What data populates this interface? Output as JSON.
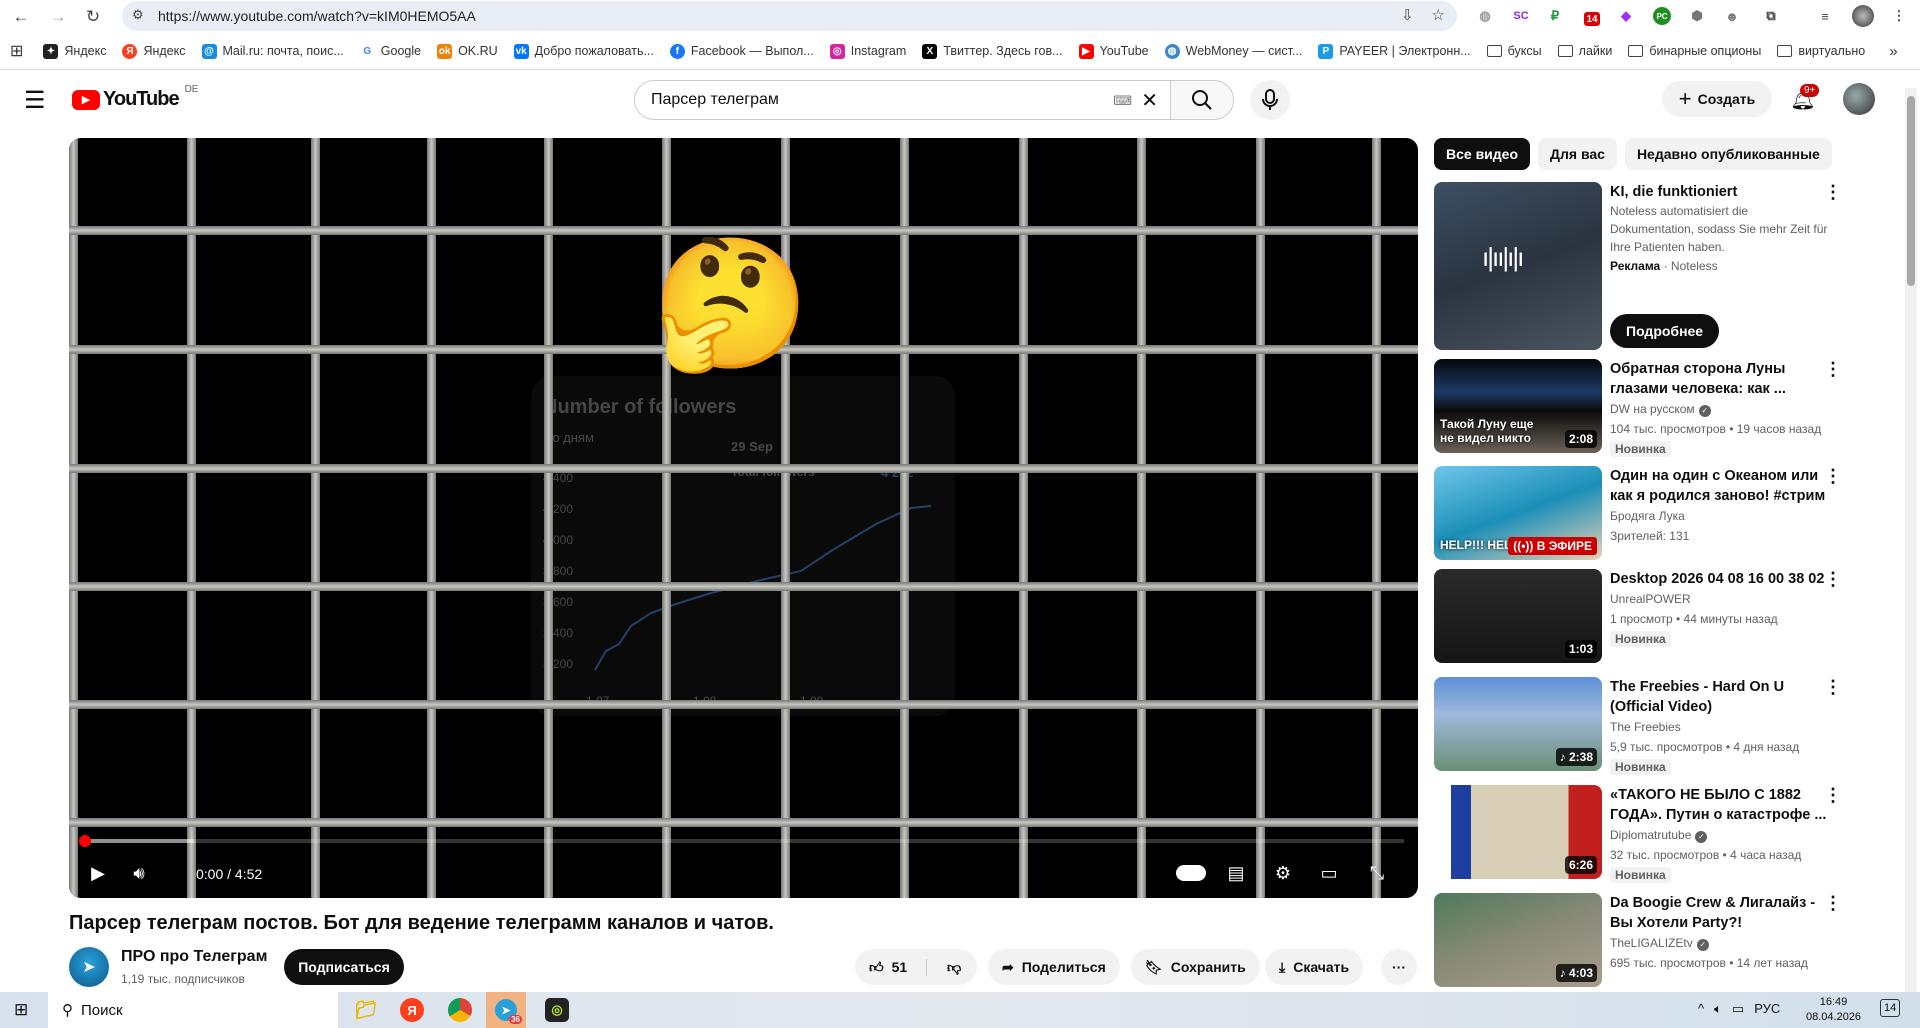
{
  "browser": {
    "url": "https://www.youtube.com/watch?v=kIM0HEMO5AA",
    "ext_badge": "14",
    "bookmarks": [
      {
        "label": "Яндекс",
        "color": "#222"
      },
      {
        "label": "Яндекс",
        "color": "#fc3f1d"
      },
      {
        "label": "Mail.ru: почта, поис...",
        "color": "#168de2"
      },
      {
        "label": "Google",
        "color": "#4285f4"
      },
      {
        "label": "OK.RU",
        "color": "#ee8208"
      },
      {
        "label": "Добро пожаловать...",
        "color": "#0077ff"
      },
      {
        "label": "Facebook — Выпол...",
        "color": "#1877f2"
      },
      {
        "label": "Instagram",
        "color": "#d6249f"
      },
      {
        "label": "Твиттер. Здесь гов...",
        "color": "#000"
      },
      {
        "label": "YouTube",
        "color": "#ff0000"
      },
      {
        "label": "WebMoney — сист...",
        "color": "#3c87c8"
      },
      {
        "label": "PAYEER | Электронн...",
        "color": "#1a9be8"
      }
    ],
    "folders": [
      "буксы",
      "лайки",
      "бинарные опционы",
      "виртуально"
    ],
    "more": "»"
  },
  "header": {
    "logo": "YouTube",
    "region": "DE",
    "search_value": "Парсер телеграм",
    "create_label": "Создать",
    "notifications": "9+"
  },
  "video": {
    "frame": {
      "chart_title": "Number of followers",
      "period": "По дням",
      "tooltip_date": "29 Sep",
      "tooltip_label": "Total followers",
      "tooltip_value": "4 252",
      "y_ticks": [
        "4 400",
        "4 200",
        "4 000",
        "3 800",
        "3 600",
        "3 400",
        "3 200"
      ],
      "x_ticks": [
        "1.07",
        "1.08",
        "1.09"
      ]
    },
    "time": "0:00 / 4:52",
    "progress": 0,
    "title": "Парсер телеграм постов. Бот для ведение телеграмм каналов и чатов.",
    "channel": {
      "name": "ПРО про Телеграм",
      "subscribers": "1,19 тыс. подписчиков",
      "subscribe_label": "Подписаться"
    },
    "actions": {
      "likes": "51",
      "share": "Поделиться",
      "save": "Сохранить",
      "download": "Скачать"
    }
  },
  "sidebar": {
    "chips": [
      "Все видео",
      "Для вас",
      "Недавно опубликованные"
    ],
    "ad": {
      "title": "KI, die funktioniert",
      "description": "Noteless automatisiert die Dokumentation, sodass Sie mehr Zeit für Ihre Patienten haben.",
      "sponsor_label": "Реклама",
      "sponsor": "Noteless",
      "cta": "Подробнее"
    },
    "items": [
      {
        "title": "Обратная сторона Луны глазами человека: как ...",
        "channel": "DW на русском",
        "verified": true,
        "meta": "104 тыс. просмотров • 19 часов назад",
        "badge": "Новинка",
        "duration": "2:08",
        "thumb_text": "Такой Луну еще не видел никто",
        "thumb": "linear-gradient(180deg,#05070c 0%,#1d3a66 35%,#0a0a0a 55%,#6b6259 100%)"
      },
      {
        "title": "Один на один с Океаном или как я родился заново! #стрим",
        "channel": "Бродяга Лука",
        "meta": "Зрителей: 131",
        "live": "В ЭФИРЕ",
        "thumb_text": "HELP!!! HELP!!!",
        "thumb": "linear-gradient(160deg,#6fc6e8,#1b8fb8 50%,#e7d3b5)"
      },
      {
        "title": "Desktop 2026 04 08   16 00 38 02",
        "channel": "UnrealPOWER",
        "meta": "1 просмотр • 44 минуты назад",
        "badge": "Новинка",
        "duration": "1:03",
        "thumb": "linear-gradient(180deg,#2b2b2b,#151515)"
      },
      {
        "title": "The Freebies - Hard On U (Official Video)",
        "channel": "The Freebies",
        "meta": "5,9 тыс. просмотров • 4 дня назад",
        "badge": "Новинка",
        "duration": "2:38",
        "music": true,
        "thumb": "linear-gradient(180deg,#5d8fd6,#9fb9dc 40%,#6a8f74)"
      },
      {
        "title": "«ТАКОГО НЕ БЫЛО С 1882 ГОДА». Путин о катастрофе ...",
        "channel": "Diplomatrutube",
        "verified": true,
        "meta": "32 тыс. просмотров • 4 часа назад",
        "badge": "Новинка",
        "duration": "6:26",
        "thumb": "linear-gradient(90deg,#fff 0 10%,#1c3fa0 10% 22%,#d8cdb5 22% 80%,#c21f1f 80%)"
      },
      {
        "title": "Da Boogie Crew & Лигалайз - Вы Хотели Party?!",
        "channel": "TheLIGALIZEtv",
        "verified": true,
        "meta": "695 тыс. просмотров • 14 лет назад",
        "duration": "4:03",
        "music": true,
        "thumb": "linear-gradient(160deg,#4f7a5a,#8a8a78 50%,#a79d8c)"
      }
    ]
  },
  "taskbar": {
    "search": "Поиск",
    "telegram_badge": "36",
    "lang": "РУС",
    "time": "16:49",
    "date": "08.04.2026",
    "notif": "14"
  },
  "colors": {
    "accent": "#ff0000",
    "dark": "#0f0f0f"
  }
}
